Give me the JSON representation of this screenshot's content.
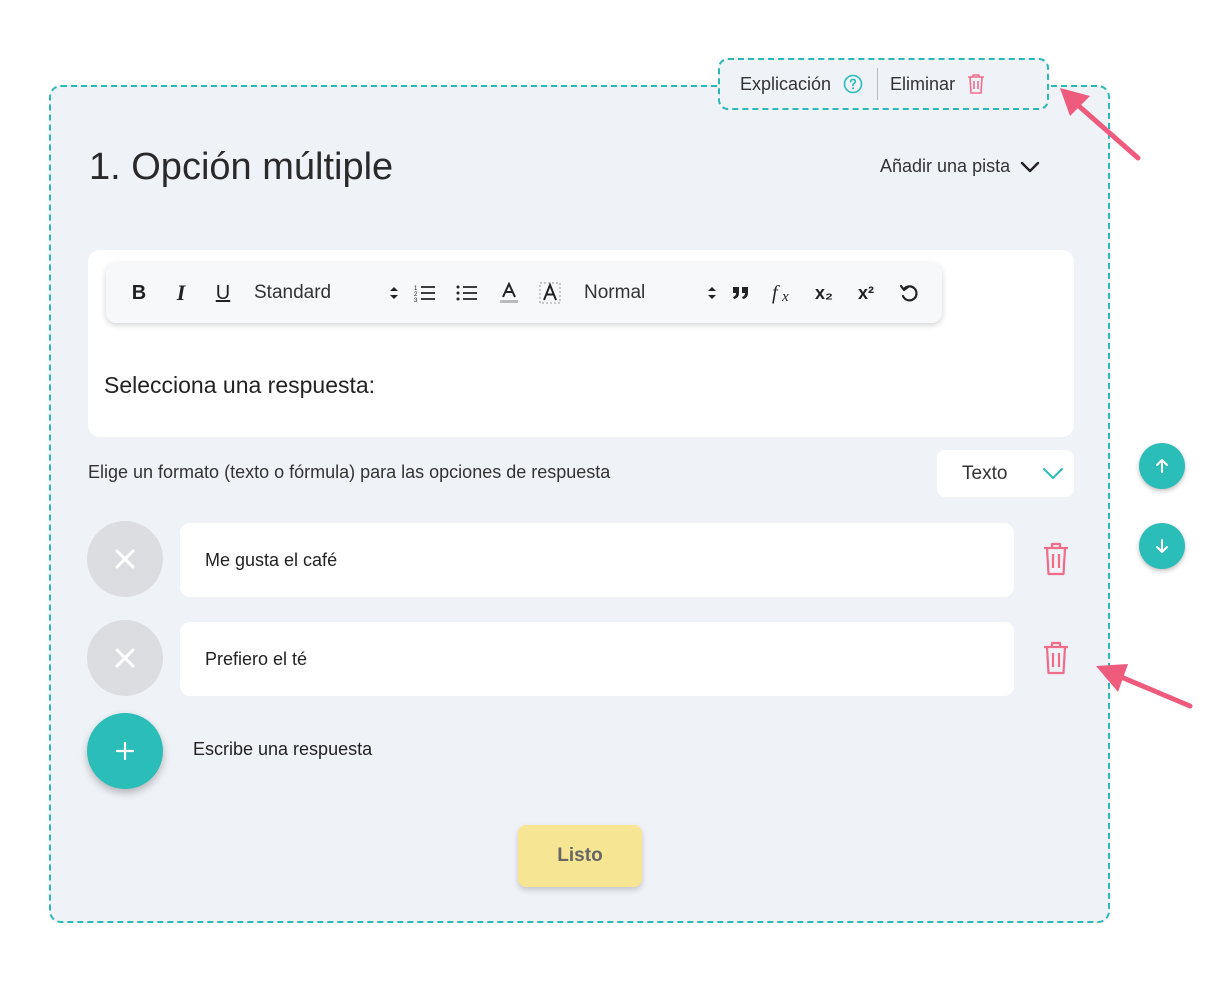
{
  "actions": {
    "explanation_label": "Explicación",
    "delete_label": "Eliminar"
  },
  "question": {
    "title": "1. Opción múltiple",
    "hint_label": "Añadir una pista"
  },
  "toolbar": {
    "bold": "B",
    "italic": "I",
    "underline": "U",
    "size_select": "Standard",
    "heading_select": "Normal",
    "subscript": "x₂",
    "superscript": "x²"
  },
  "editor": {
    "text": "Selecciona una respuesta:"
  },
  "format": {
    "label": "Elige un formato (texto o fórmula) para las opciones de respuesta",
    "selected": "Texto"
  },
  "answers": [
    {
      "text": "Me gusta el café"
    },
    {
      "text": "Prefiero el té"
    }
  ],
  "add_answer_label": "Escribe una respuesta",
  "done_label": "Listo",
  "colors": {
    "teal": "#2bbdb8",
    "delete": "#f06d8a",
    "done": "#f6e592",
    "arrow": "#ef5b7d"
  },
  "icons": [
    "help-icon",
    "trash-icon",
    "chevron-down-icon",
    "close-icon",
    "plus-icon",
    "arrow-up-icon",
    "arrow-down-icon"
  ]
}
